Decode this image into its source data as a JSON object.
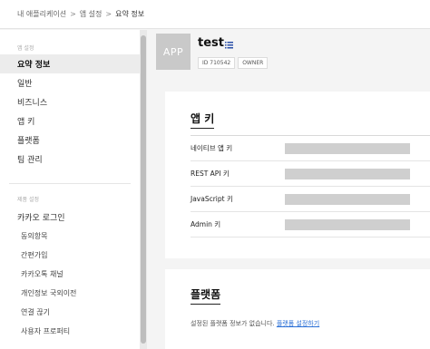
{
  "breadcrumb": [
    "내 애플리케이션",
    "앱 설정",
    "요약 정보"
  ],
  "sidebar": {
    "section1": "앱 설정",
    "items": [
      "요약 정보",
      "일반",
      "비즈니스",
      "앱 키",
      "플랫폼",
      "팀 관리"
    ],
    "section2": "제품 설정",
    "product": "카카오 로그인",
    "sub_items": [
      "동의항목",
      "간편가입",
      "카카오톡 채널",
      "개인정보 국외이전",
      "연결 끊기",
      "사용자 프로퍼티"
    ]
  },
  "app": {
    "logo_text": "APP",
    "name": "test",
    "id": "ID 710542",
    "role": "OWNER"
  },
  "app_keys": {
    "title": "앱 키",
    "rows": [
      "네이티브 앱 키",
      "REST API 키",
      "JavaScript 키",
      "Admin 키"
    ]
  },
  "platform": {
    "title": "플랫폼",
    "message": "설정된 플랫폼 정보가 없습니다.",
    "link": "플랫폼 설정하기"
  },
  "colors": {
    "link": "#2a6fd6",
    "active_item_bg": "#ececec",
    "masked_key": "#cfcfcf"
  }
}
